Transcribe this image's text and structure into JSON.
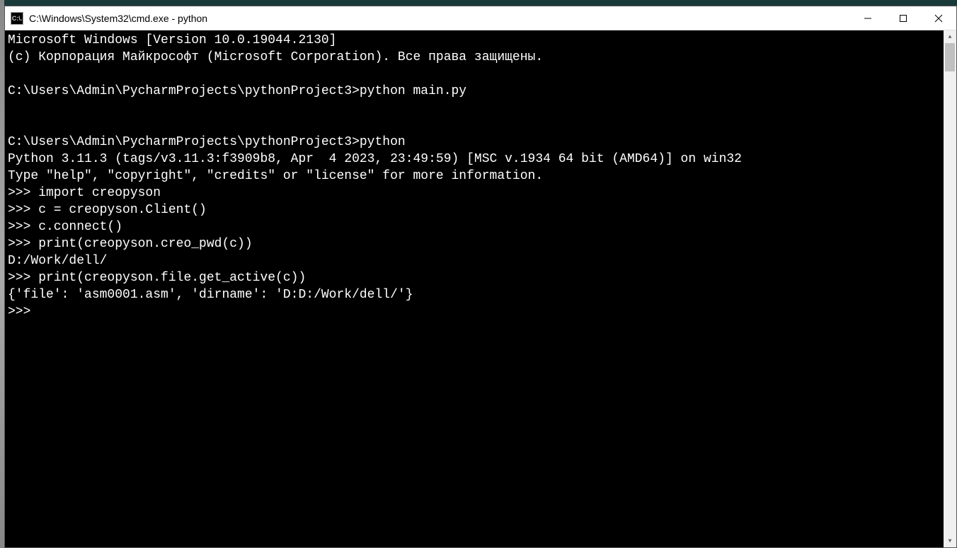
{
  "window": {
    "title": "C:\\Windows\\System32\\cmd.exe - python",
    "icon_label": "C:\\."
  },
  "terminal": {
    "lines": [
      "Microsoft Windows [Version 10.0.19044.2130]",
      "(c) Корпорация Майкрософт (Microsoft Corporation). Все права защищены.",
      "",
      "C:\\Users\\Admin\\PycharmProjects\\pythonProject3>python main.py",
      "",
      "",
      "C:\\Users\\Admin\\PycharmProjects\\pythonProject3>python",
      "Python 3.11.3 (tags/v3.11.3:f3909b8, Apr  4 2023, 23:49:59) [MSC v.1934 64 bit (AMD64)] on win32",
      "Type \"help\", \"copyright\", \"credits\" or \"license\" for more information.",
      ">>> import creopyson",
      ">>> c = creopyson.Client()",
      ">>> c.connect()",
      ">>> print(creopyson.creo_pwd(c))",
      "D:/Work/dell/",
      ">>> print(creopyson.file.get_active(c))",
      "{'file': 'asm0001.asm', 'dirname': 'D:D:/Work/dell/'}",
      ">>>"
    ]
  }
}
